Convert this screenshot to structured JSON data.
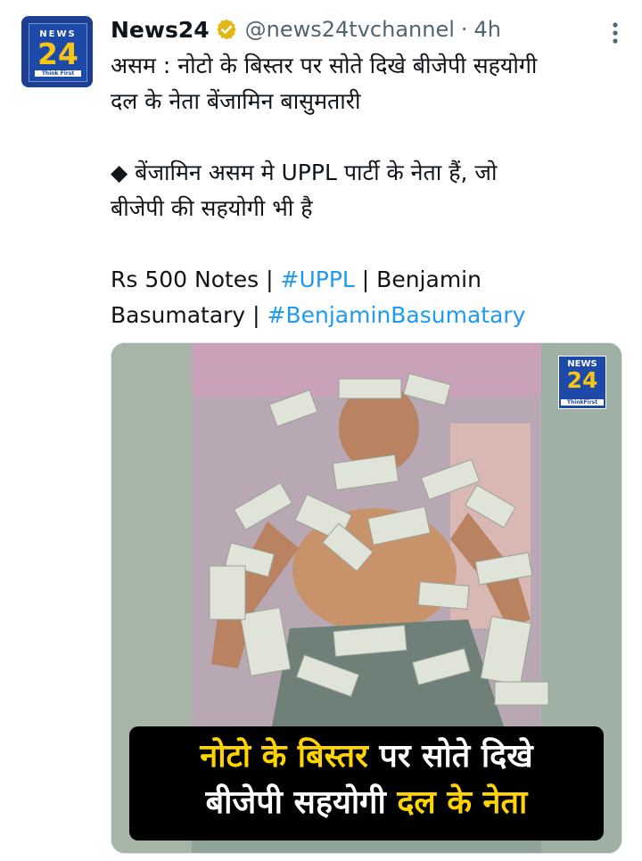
{
  "tweet": {
    "author": "News24",
    "handle": "@news24tvchannel",
    "separator": "·",
    "time": "4h",
    "avatar": {
      "top": "NEWS",
      "big": "24",
      "tagline": "Think First"
    },
    "text": {
      "line1": "असम : नोटो के बिस्तर पर सोते दिखे बीजेपी सहयोगी",
      "line2": "दल के नेता बेंजामिन बासुमतारी",
      "line3": "◆ बेंजामिन असम मे UPPL पार्टी के नेता हैं, जो",
      "line4": "बीजेपी की सहयोगी भी है",
      "line5_a": "Rs 500 Notes | ",
      "line5_tag": "#UPPL",
      "line5_b": " | Benjamin",
      "line6_a": "Basumatary | ",
      "line6_tag": "#BenjaminBasumatary"
    },
    "media": {
      "watermark": {
        "top": "NEWS",
        "big": "24",
        "tagline": "ThinkFirst"
      },
      "caption": {
        "l1_yellow": "नोटो के बिस्तर",
        "l1_white": " पर सोते दिखे",
        "l2_white": "बीजेपी सहयोगी ",
        "l2_yellow": "दल के नेता"
      }
    }
  },
  "colors": {
    "link": "#1d9bf0",
    "verified": "#e2b719",
    "muted": "#536471",
    "highlight": "#ffd400"
  },
  "icons": {
    "verified": "verified-badge-icon",
    "more": "more-options-icon"
  }
}
